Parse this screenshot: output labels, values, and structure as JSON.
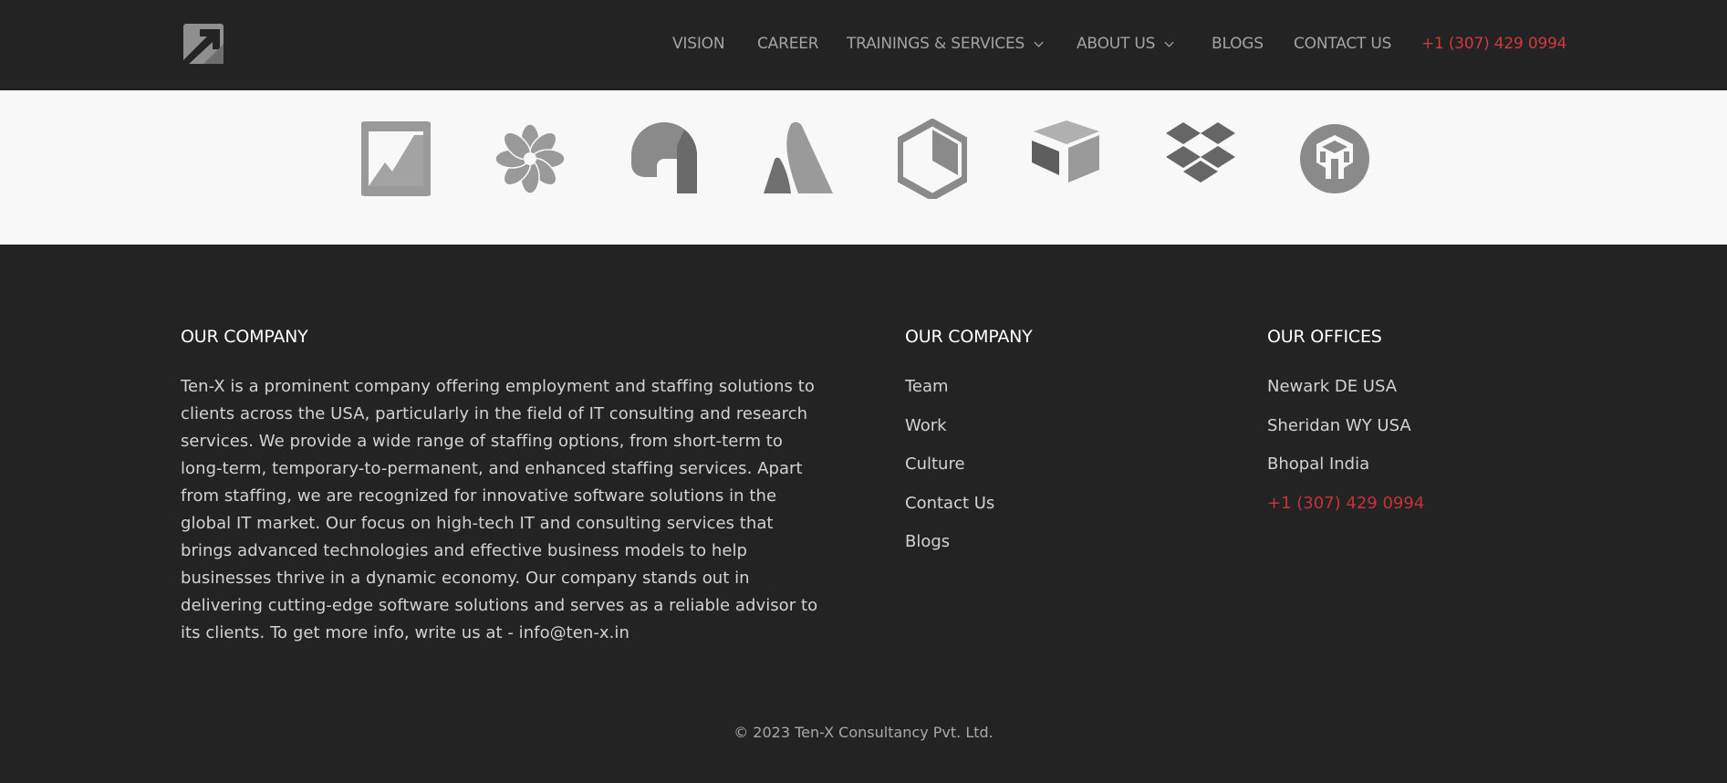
{
  "header": {
    "logo_alt": "Ten-X logo",
    "nav": [
      {
        "label": "VISION",
        "has_dropdown": false
      },
      {
        "label": "CAREER",
        "has_dropdown": false
      },
      {
        "label": "TRAININGS & SERVICES",
        "has_dropdown": true
      },
      {
        "label": "ABOUT US",
        "has_dropdown": true
      },
      {
        "label": "BLOGS",
        "has_dropdown": false
      },
      {
        "label": "CONTACT US",
        "has_dropdown": false
      }
    ],
    "phone": "+1 (307) 429 0994"
  },
  "partners": {
    "logos": [
      "partner-logo-square-icon",
      "partner-logo-flower-icon",
      "partner-logo-arch-icon",
      "partner-logo-atlassian-icon",
      "partner-logo-hexagon-icon",
      "partner-logo-cube-icon",
      "partner-logo-dropbox-icon",
      "partner-logo-circle-icon"
    ]
  },
  "footer": {
    "company": {
      "title": "OUR COMPANY",
      "text": "Ten-X is a prominent company offering employment and staffing solutions to clients across the USA, particularly in the field of IT consulting and research services. We provide a wide range of staffing options, from short-term to long-term, temporary-to-permanent, and enhanced staffing services. Apart from staffing, we are recognized for innovative software solutions in the global IT market. Our focus on high-tech IT and consulting services that brings advanced technologies and effective business models to help businesses thrive in a dynamic economy. Our company stands out in delivering cutting-edge software solutions and serves as a reliable advisor to its clients. To get more info, write us at - info@ten-x.in"
    },
    "links": {
      "title": "OUR COMPANY",
      "items": [
        "Team",
        "Work",
        "Culture",
        "Contact Us",
        "Blogs"
      ]
    },
    "offices": {
      "title": "OUR OFFICES",
      "items": [
        "Newark DE USA",
        "Sheridan WY USA",
        "Bhopal India"
      ],
      "phone": "+1 (307) 429 0994"
    },
    "copyright": "© 2023 Ten-X Consultancy Pvt. Ltd."
  },
  "colors": {
    "background": "#232323",
    "strip": "#f8f8f8",
    "accent": "#c7313a",
    "logo_gray": "#9a9a9a"
  }
}
